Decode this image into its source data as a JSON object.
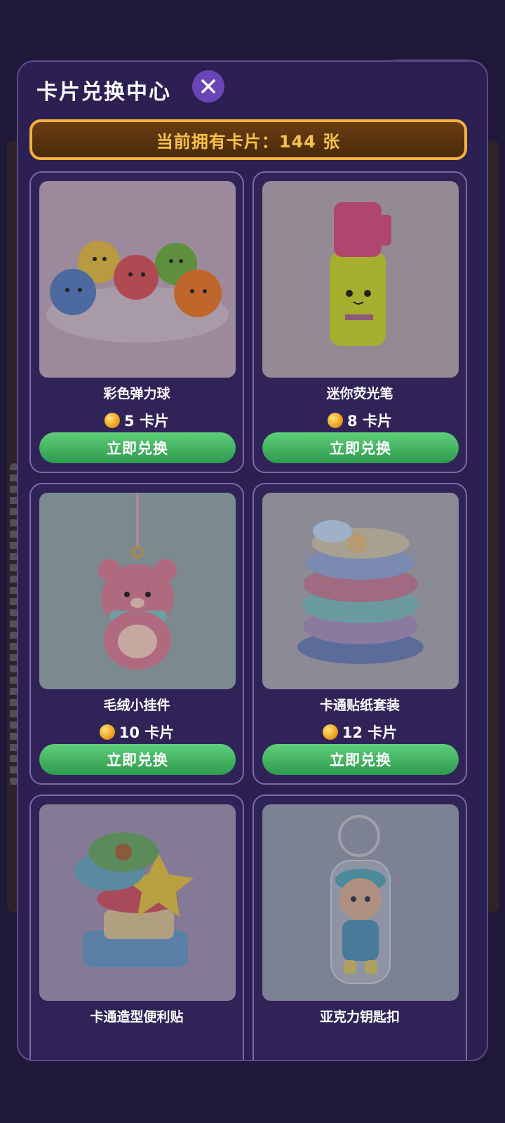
{
  "header": {
    "title": "卡片兑换中心"
  },
  "balance": {
    "label": "当前拥有卡片：144 张"
  },
  "products": [
    {
      "name": "彩色弹力球",
      "price": "5 卡片",
      "button": "立即兑换"
    },
    {
      "name": "迷你荧光笔",
      "price": "8 卡片",
      "button": "立即兑换"
    },
    {
      "name": "毛绒小挂件",
      "price": "10 卡片",
      "button": "立即兑换"
    },
    {
      "name": "卡通贴纸套装",
      "price": "12 卡片",
      "button": "立即兑换"
    },
    {
      "name": "卡通造型便利贴",
      "price": "",
      "button": ""
    },
    {
      "name": "亚克力钥匙扣",
      "price": "",
      "button": ""
    }
  ],
  "colors": {
    "modal_bg": "#2c2052",
    "balance_border": "#f2b13d",
    "button_green": "#2e9a4d",
    "close_purple": "#6a45b8"
  }
}
